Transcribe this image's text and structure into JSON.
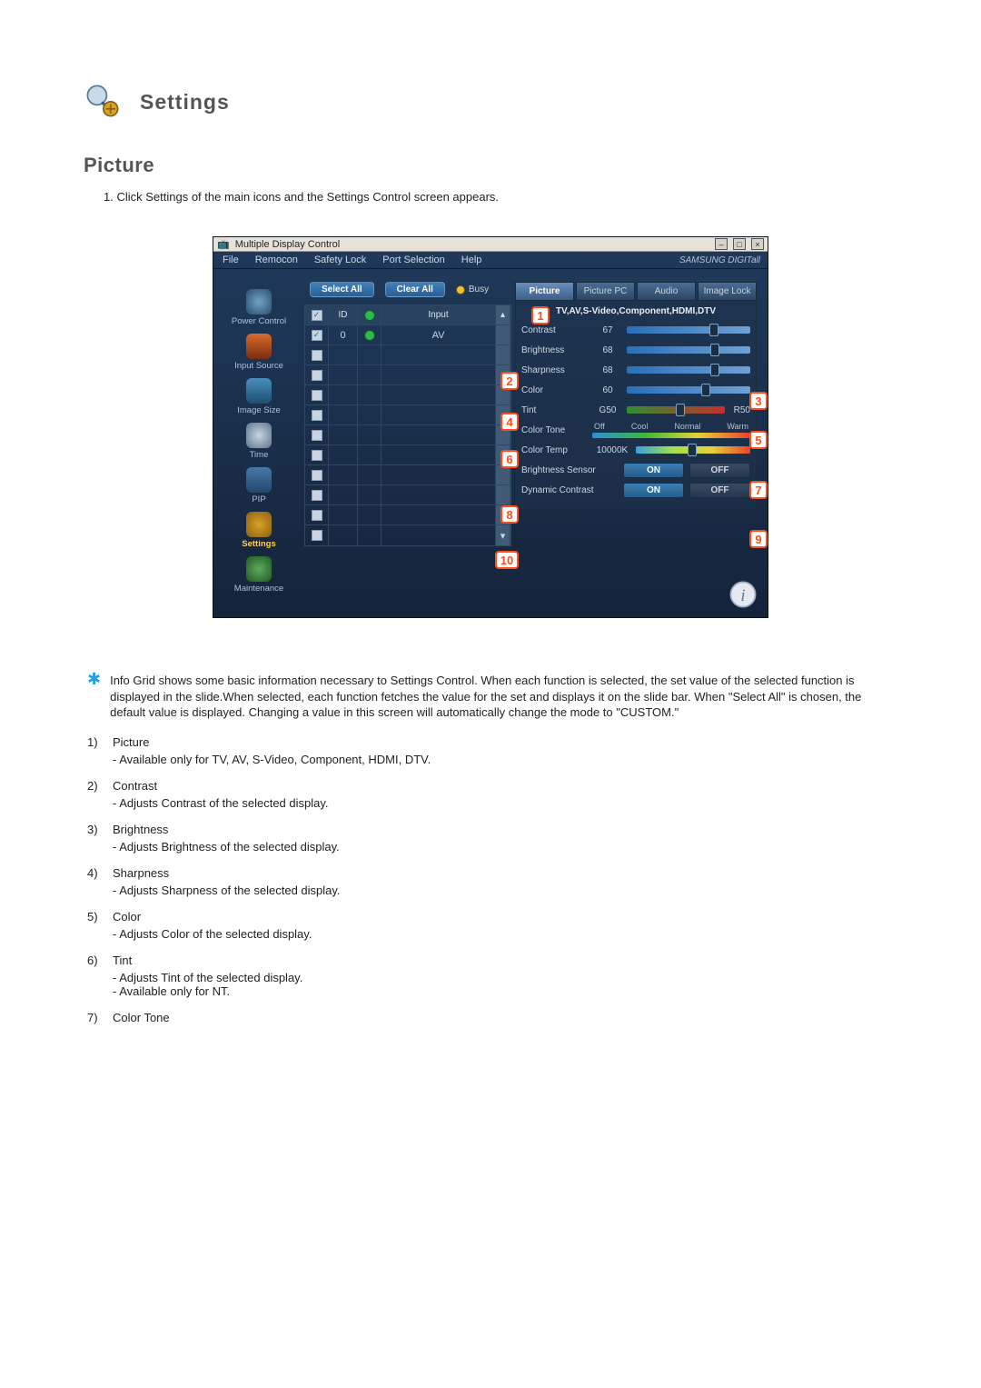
{
  "header": {
    "title": "Settings"
  },
  "section": {
    "title": "Picture"
  },
  "step1": "1.  Click Settings of the main icons and the Settings Control screen appears.",
  "app": {
    "windowTitle": "Multiple Display Control",
    "menubar": [
      "File",
      "Remocon",
      "Safety Lock",
      "Port Selection",
      "Help"
    ],
    "brand": "SAMSUNG DIGITall",
    "toolbar": {
      "selectAll": "Select All",
      "clearAll": "Clear All",
      "busy": "Busy"
    },
    "sidebar": [
      {
        "label": "Power Control"
      },
      {
        "label": "Input Source"
      },
      {
        "label": "Image Size"
      },
      {
        "label": "Time"
      },
      {
        "label": "PIP"
      },
      {
        "label": "Settings",
        "active": true
      },
      {
        "label": "Maintenance"
      }
    ],
    "grid": {
      "headers": {
        "id": "ID",
        "input": "Input"
      },
      "rows": [
        {
          "checked": true,
          "id": "0",
          "status": "ok",
          "input": "AV"
        },
        {
          "checked": false
        },
        {
          "checked": false
        },
        {
          "checked": false
        },
        {
          "checked": false
        },
        {
          "checked": false
        },
        {
          "checked": false
        },
        {
          "checked": false
        },
        {
          "checked": false
        },
        {
          "checked": false
        },
        {
          "checked": false
        }
      ]
    },
    "tabs": [
      "Picture",
      "Picture PC",
      "Audio",
      "Image Lock"
    ],
    "panelSub": "TV,AV,S-Video,Component,HDMI,DTV",
    "sliders": {
      "contrast": {
        "label": "Contrast",
        "value": "67",
        "pct": 67
      },
      "brightness": {
        "label": "Brightness",
        "value": "68",
        "pct": 68
      },
      "sharpness": {
        "label": "Sharpness",
        "value": "68",
        "pct": 68
      },
      "color": {
        "label": "Color",
        "value": "60",
        "pct": 60
      },
      "tint": {
        "label": "Tint",
        "left": "G50",
        "right": "R50",
        "pct": 50
      }
    },
    "colorTone": {
      "label": "Color Tone",
      "options": [
        "Off",
        "Cool",
        "Normal",
        "Warm"
      ]
    },
    "colorTemp": {
      "label": "Color Temp",
      "value": "10000K",
      "pct": 45
    },
    "brightnessSensor": {
      "label": "Brightness Sensor",
      "on": "ON",
      "off": "OFF"
    },
    "dynamicContrast": {
      "label": "Dynamic Contrast",
      "on": "ON",
      "off": "OFF"
    }
  },
  "callouts": [
    "1",
    "2",
    "3",
    "4",
    "5",
    "6",
    "7",
    "8",
    "9",
    "10"
  ],
  "notes": {
    "star": "Info Grid shows some basic information necessary to Settings Control.\nWhen each function is selected, the set value of the selected function is displayed in the slide.When selected, each function fetches the value for the set and displays it on the slide bar. When \"Select All\" is chosen, the default value is displayed. Changing a value in this screen will automatically change the mode to \"CUSTOM.\"",
    "items": [
      {
        "n": "1)",
        "title": "Picture",
        "subs": [
          "Available only for TV, AV, S-Video, Component, HDMI, DTV."
        ]
      },
      {
        "n": "2)",
        "title": "Contrast",
        "subs": [
          "Adjusts Contrast of the selected display."
        ]
      },
      {
        "n": "3)",
        "title": "Brightness",
        "subs": [
          "Adjusts Brightness of the selected display."
        ]
      },
      {
        "n": "4)",
        "title": "Sharpness",
        "subs": [
          "Adjusts Sharpness of the selected display."
        ]
      },
      {
        "n": "5)",
        "title": "Color",
        "subs": [
          "Adjusts Color of the selected display."
        ]
      },
      {
        "n": "6)",
        "title": "Tint",
        "subs": [
          "Adjusts Tint of the selected display.",
          "Available  only for NT."
        ]
      },
      {
        "n": "7)",
        "title": "Color Tone",
        "subs": []
      }
    ]
  }
}
